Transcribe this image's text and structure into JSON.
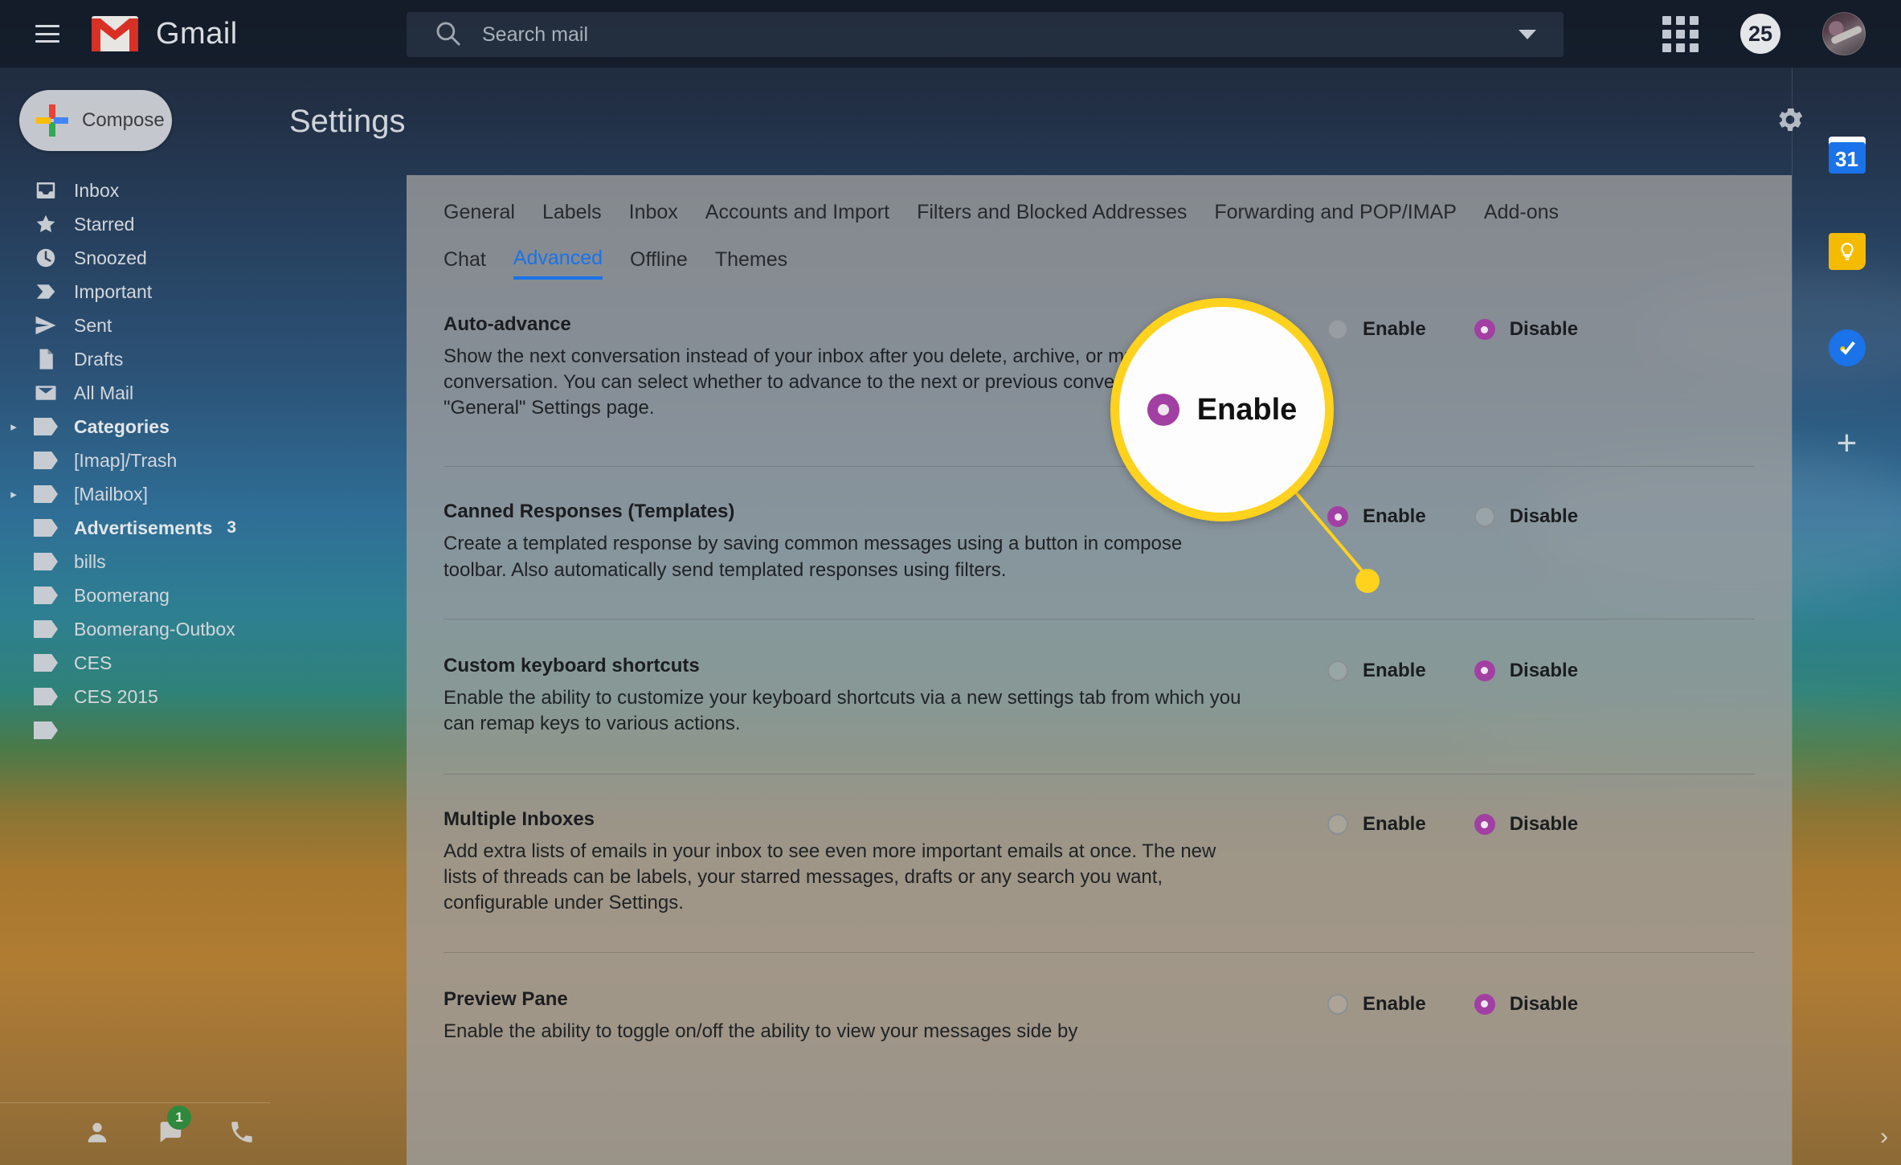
{
  "app": {
    "name": "Gmail",
    "logo_icon": "gmail-m-logo",
    "menu_icon": "hamburger-menu-icon"
  },
  "search": {
    "placeholder": "Search mail",
    "value": "",
    "icon": "search-icon",
    "options_icon": "chevron-down-icon"
  },
  "topbar": {
    "apps_icon": "apps-grid-icon",
    "unread_badge": "25",
    "avatar_icon": "user-avatar"
  },
  "sidebar": {
    "compose": {
      "label": "Compose",
      "icon": "plus-icon"
    },
    "items": [
      {
        "label": "Inbox",
        "icon": "inbox-icon",
        "bold": false,
        "twisty": false,
        "count": ""
      },
      {
        "label": "Starred",
        "icon": "star-icon",
        "bold": false,
        "twisty": false,
        "count": ""
      },
      {
        "label": "Snoozed",
        "icon": "clock-icon",
        "bold": false,
        "twisty": false,
        "count": ""
      },
      {
        "label": "Important",
        "icon": "label-important-icon",
        "bold": false,
        "twisty": false,
        "count": ""
      },
      {
        "label": "Sent",
        "icon": "send-icon",
        "bold": false,
        "twisty": false,
        "count": ""
      },
      {
        "label": "Drafts",
        "icon": "draft-icon",
        "bold": false,
        "twisty": false,
        "count": ""
      },
      {
        "label": "All Mail",
        "icon": "mail-icon",
        "bold": false,
        "twisty": false,
        "count": ""
      },
      {
        "label": "Categories",
        "icon": "tag-icon",
        "bold": true,
        "twisty": true,
        "count": ""
      },
      {
        "label": "[Imap]/Trash",
        "icon": "tag-icon",
        "bold": false,
        "twisty": false,
        "count": ""
      },
      {
        "label": "[Mailbox]",
        "icon": "tag-icon",
        "bold": false,
        "twisty": true,
        "count": ""
      },
      {
        "label": "Advertisements",
        "icon": "tag-icon",
        "bold": true,
        "twisty": false,
        "count": "3"
      },
      {
        "label": "bills",
        "icon": "tag-icon",
        "bold": false,
        "twisty": false,
        "count": ""
      },
      {
        "label": "Boomerang",
        "icon": "tag-icon",
        "bold": false,
        "twisty": false,
        "count": ""
      },
      {
        "label": "Boomerang-Outbox",
        "icon": "tag-icon",
        "bold": false,
        "twisty": false,
        "count": ""
      },
      {
        "label": "CES",
        "icon": "tag-icon",
        "bold": false,
        "twisty": false,
        "count": ""
      },
      {
        "label": "CES 2015",
        "icon": "tag-icon",
        "bold": false,
        "twisty": false,
        "count": ""
      },
      {
        "label": "",
        "icon": "tag-icon",
        "bold": false,
        "twisty": false,
        "count": ""
      }
    ],
    "footer": {
      "person_icon": "person-icon",
      "chat_icon": "chat-icon",
      "chat_badge": "1",
      "phone_icon": "phone-icon"
    }
  },
  "settings": {
    "title": "Settings",
    "gear_icon": "gear-icon",
    "tabs_primary": [
      "General",
      "Labels",
      "Inbox",
      "Accounts and Import",
      "Filters and Blocked Addresses",
      "Forwarding and POP/IMAP",
      "Add-ons"
    ],
    "tabs_secondary": [
      {
        "label": "Chat",
        "active": false
      },
      {
        "label": "Advanced",
        "active": true
      },
      {
        "label": "Offline",
        "active": false
      },
      {
        "label": "Themes",
        "active": false
      }
    ],
    "enable_label": "Enable",
    "disable_label": "Disable",
    "sections": [
      {
        "title": "Auto-advance",
        "desc": "Show the next conversation instead of your inbox after you delete, archive, or mute a conversation. You can select whether to advance to the next or previous conversation in the \"General\" Settings page.",
        "selected": "Disable"
      },
      {
        "title": "Canned Responses (Templates)",
        "desc": "Create a templated response by saving common messages using a button in compose toolbar. Also automatically send templated responses using filters.",
        "selected": "Enable"
      },
      {
        "title": "Custom keyboard shortcuts",
        "desc": "Enable the ability to customize your keyboard shortcuts via a new settings tab from which you can remap keys to various actions.",
        "selected": "Disable"
      },
      {
        "title": "Multiple Inboxes",
        "desc": "Add extra lists of emails in your inbox to see even more important emails at once. The new lists of threads can be labels, your starred messages, drafts or any search you want, configurable under Settings.",
        "selected": "Disable"
      },
      {
        "title": "Preview Pane",
        "desc": "Enable the ability to toggle on/off the ability to view your messages side by",
        "selected": "Disable"
      }
    ]
  },
  "callout": {
    "label": "Enable",
    "radio_state": "checked",
    "ring_color": "#ffd21e",
    "points_to": "Canned Responses (Templates) Enable radio"
  },
  "right_panel": {
    "items": [
      {
        "name": "google-calendar-icon",
        "label": "31"
      },
      {
        "name": "google-keep-icon",
        "label": ""
      },
      {
        "name": "google-tasks-icon",
        "label": ""
      }
    ],
    "add_label": "+",
    "expand_icon": "chevron-right-icon"
  },
  "colors": {
    "accent_blue": "#1a73e8",
    "radio_selected": "#a23fa2",
    "callout_yellow": "#ffd21e",
    "badge_green": "#1e8e3e"
  }
}
